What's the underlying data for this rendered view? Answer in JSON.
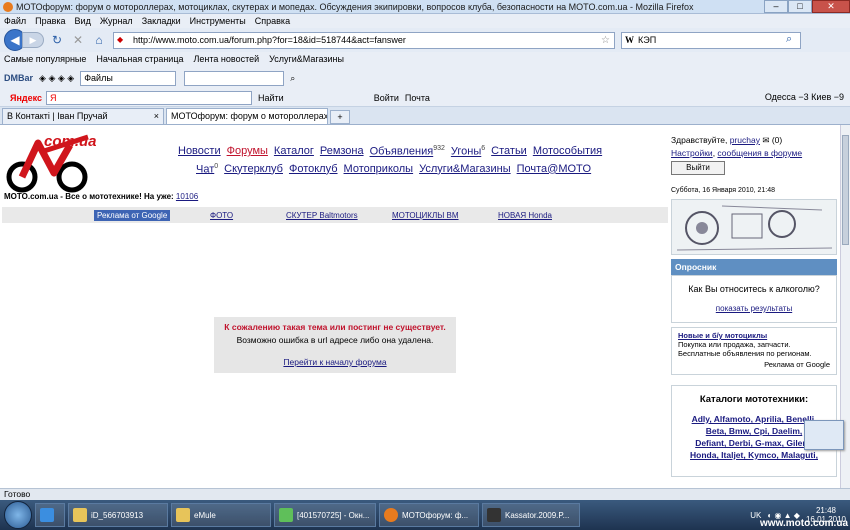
{
  "window": {
    "title": "МОТОфорум: форум о мотороллерах, мотоциклах, скутерах и мопедах. Обсуждения экипировки, вопросов клуба, безопасности на MOTO.com.ua - Mozilla Firefox",
    "min": "–",
    "max": "□",
    "close": "✕"
  },
  "menu": [
    "Файл",
    "Правка",
    "Вид",
    "Журнал",
    "Закладки",
    "Инструменты",
    "Справка"
  ],
  "nav": {
    "url": "http://www.moto.com.ua/forum.php?for=18&id=518744&act=fanswer",
    "search_engine": "W",
    "search_value": "КЭП"
  },
  "bookmarks": [
    "Самые популярные",
    "Начальная страница",
    "Лента новостей",
    "Услуги&Магазины"
  ],
  "dmbar": {
    "logo": "DMBar",
    "select_label": "Файлы"
  },
  "yabar": {
    "logo": "Яндекс",
    "input_value": "Я",
    "items": [
      "Найти",
      "Войти",
      "Почта"
    ],
    "weather": "Одесса  −3   Киев  −9"
  },
  "tabs": [
    {
      "label": "В Контакті | Іван Пручай",
      "close": "×"
    },
    {
      "label": "МОТОфорум: форум о мотороллерах...",
      "close": "×"
    }
  ],
  "site": {
    "logo_text": "com.ua",
    "nav_row1": [
      {
        "label": "Новости",
        "sup": ""
      },
      {
        "label": "Форумы",
        "sup": "",
        "hot": true
      },
      {
        "label": "Каталог",
        "sup": ""
      },
      {
        "label": "Ремзона",
        "sup": ""
      },
      {
        "label": "Объявления",
        "sup": "932"
      },
      {
        "label": "Угоны",
        "sup": "6"
      },
      {
        "label": "Статьи",
        "sup": ""
      },
      {
        "label": "Мотособытия",
        "sup": ""
      }
    ],
    "nav_row2": [
      {
        "label": "Чат",
        "sup": "0"
      },
      {
        "label": "Скутерклуб",
        "sup": ""
      },
      {
        "label": "Фотоклуб",
        "sup": ""
      },
      {
        "label": "Мотоприколы",
        "sup": ""
      },
      {
        "label": "Услуги&Магазины",
        "sup": ""
      },
      {
        "label": "Почта@MOTO",
        "sup": ""
      }
    ],
    "tagline": "MOTO.com.ua - Все о мототехнике!  На уже:",
    "tagline_num": "10106",
    "ads": [
      "Реклама от Google",
      "ФОТО",
      "СКУТЕР Baltmotors",
      "МОТОЦИКЛЫ BM",
      "НОВАЯ Honda"
    ],
    "error": {
      "line1": "К сожалению такая тема или постинг не существует.",
      "line2": "Возможно ошибка в url адресе либо она удалена.",
      "link": "Перейти к началу форума"
    },
    "sidebar": {
      "hello": "Здравствуйте,",
      "user": "pruchay",
      "msg_count": "(0)",
      "settings": "Настройки",
      "messages": "сообщения в форуме",
      "logout": "Выйти",
      "date": "Суббота, 16 Января 2010,  21:48",
      "poll_header": "Опросник",
      "poll_question": "Как Вы относитесь к алкоголю?",
      "poll_link": "показать результаты",
      "ad_title": "Новые и б/у мотоциклы",
      "ad_text": "Покупка или продажа, запчасти. Бесплатные объявления по регионам.",
      "ad_by": "Реклама от Google",
      "catalog_header": "Каталоги мототехники:",
      "catalog_line1": "Adly, Alfamoto, Aprilia, Benelli,",
      "catalog_line2": "Beta, Bmw, Cpi, Daelim,",
      "catalog_line3": "Defiant, Derbi, G-max, Gilera,",
      "catalog_line4": "Honda, Italjet, Kymco, Malaguti,"
    }
  },
  "status": "Готово",
  "taskbar": {
    "items": [
      "iD_566703913",
      "eMule",
      "[401570725] - Окн...",
      "МОТОфорум: ф...",
      "Kassator.2009.P..."
    ],
    "lang": "UK",
    "time": "21:48",
    "date": "16.01.2010",
    "watermark": "www.moto.com.ua"
  }
}
